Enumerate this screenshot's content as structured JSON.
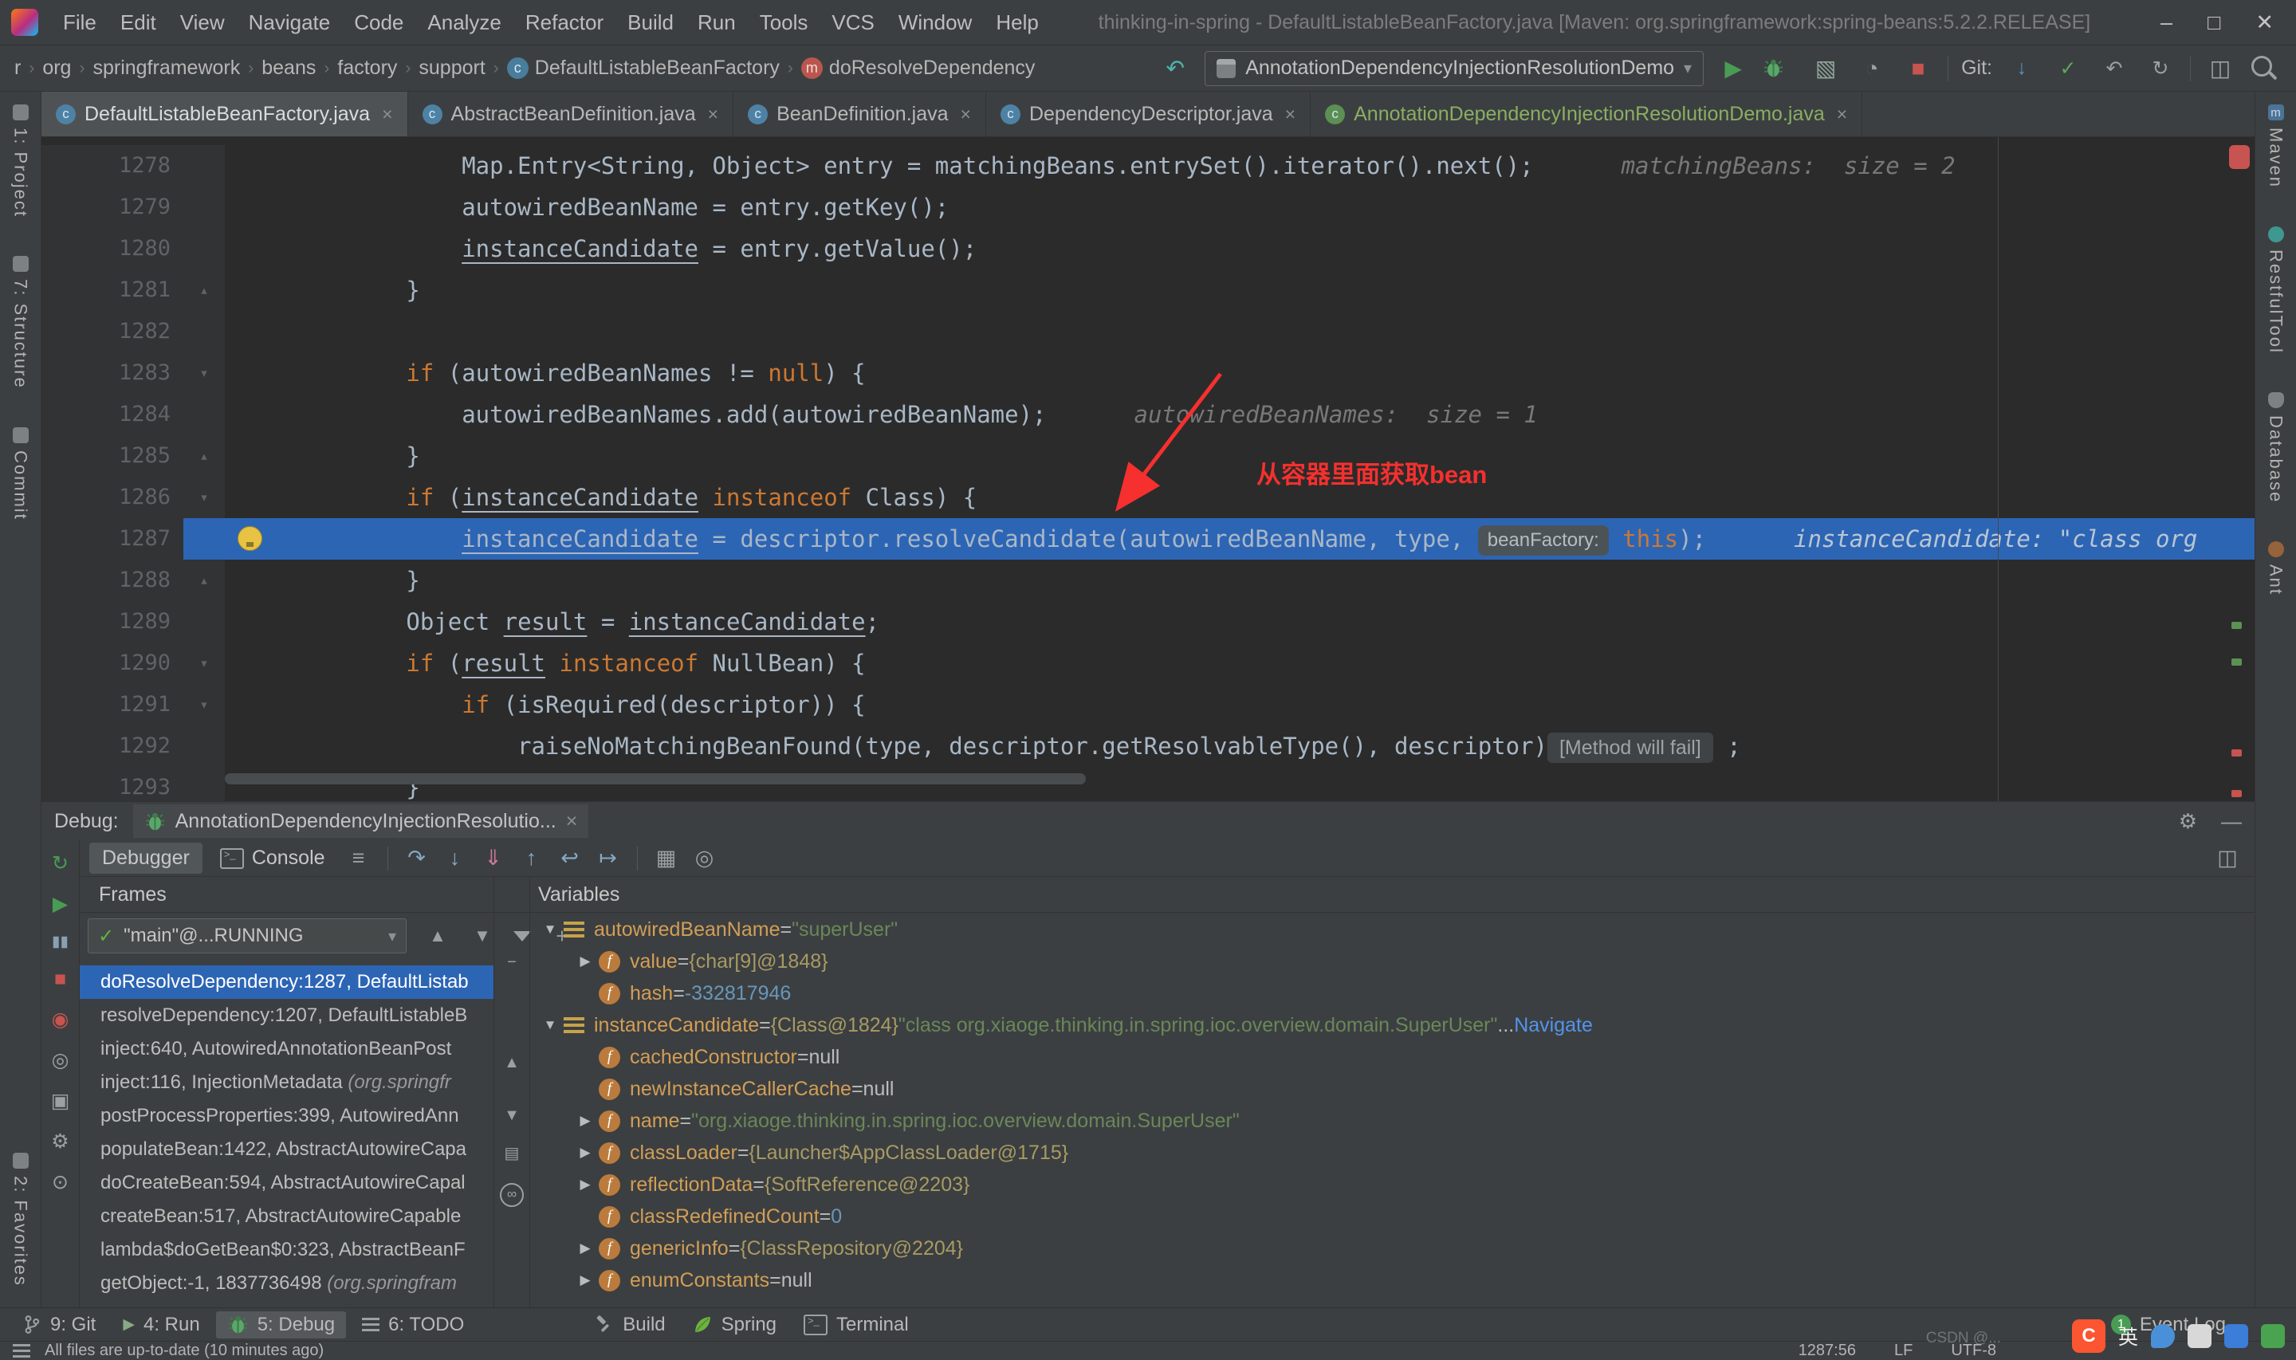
{
  "window": {
    "title": "thinking-in-spring - DefaultListableBeanFactory.java [Maven: org.springframework:spring-beans:5.2.2.RELEASE]"
  },
  "menu": {
    "items": [
      "File",
      "Edit",
      "View",
      "Navigate",
      "Code",
      "Analyze",
      "Refactor",
      "Build",
      "Run",
      "Tools",
      "VCS",
      "Window",
      "Help"
    ]
  },
  "toolbar": {
    "breadcrumbs": [
      {
        "label": "r"
      },
      {
        "label": "org"
      },
      {
        "label": "springframework"
      },
      {
        "label": "beans"
      },
      {
        "label": "factory"
      },
      {
        "label": "support"
      },
      {
        "label": "DefaultListableBeanFactory",
        "icon": "class"
      },
      {
        "label": "doResolveDependency",
        "icon": "method"
      }
    ],
    "run_config": "AnnotationDependencyInjectionResolutionDemo",
    "git_label": "Git:"
  },
  "tabs": [
    {
      "label": "DefaultListableBeanFactory.java",
      "active": true
    },
    {
      "label": "AbstractBeanDefinition.java"
    },
    {
      "label": "BeanDefinition.java"
    },
    {
      "label": "DependencyDescriptor.java"
    },
    {
      "label": "AnnotationDependencyInjectionResolutionDemo.java",
      "green": true
    }
  ],
  "editor": {
    "annotation": "从容器里面获取bean",
    "lines": [
      {
        "num": 1278,
        "ind": 16,
        "seg": [
          {
            "t": "Map.Entry<String, Object> entry = matchingBeans.entrySet().iterator().next();",
            "s": "d"
          }
        ],
        "hint": "matchingBeans:  size = 2"
      },
      {
        "num": 1279,
        "ind": 16,
        "seg": [
          {
            "t": "autowiredBeanName = entry.getKey();",
            "s": "d"
          }
        ]
      },
      {
        "num": 1280,
        "ind": 16,
        "seg": [
          {
            "t": "instanceCandidate",
            "s": "u"
          },
          {
            "t": " = entry.getValue();",
            "s": "d"
          }
        ]
      },
      {
        "num": 1281,
        "ind": 12,
        "seg": [
          {
            "t": "}",
            "s": "d"
          }
        ],
        "fold": "end"
      },
      {
        "num": 1282,
        "ind": 0,
        "seg": []
      },
      {
        "num": 1283,
        "ind": 12,
        "seg": [
          {
            "t": "if ",
            "s": "k"
          },
          {
            "t": "(autowiredBeanNames != ",
            "s": "d"
          },
          {
            "t": "null",
            "s": "k"
          },
          {
            "t": ") {",
            "s": "d"
          }
        ],
        "fold": "start"
      },
      {
        "num": 1284,
        "ind": 16,
        "seg": [
          {
            "t": "autowiredBeanNames.add(autowiredBeanName);",
            "s": "d"
          }
        ],
        "hint": "autowiredBeanNames:  size = 1"
      },
      {
        "num": 1285,
        "ind": 12,
        "seg": [
          {
            "t": "}",
            "s": "d"
          }
        ],
        "fold": "end"
      },
      {
        "num": 1286,
        "ind": 12,
        "seg": [
          {
            "t": "if ",
            "s": "k"
          },
          {
            "t": "(",
            "s": "d"
          },
          {
            "t": "instanceCandidate",
            "s": "u"
          },
          {
            "t": " ",
            "s": "d"
          },
          {
            "t": "instanceof ",
            "s": "k"
          },
          {
            "t": "Class) {",
            "s": "d"
          }
        ],
        "fold": "start"
      },
      {
        "num": 1287,
        "ind": 16,
        "current": true,
        "bulb": true,
        "seg": [
          {
            "t": "instanceCandidate",
            "s": "u"
          },
          {
            "t": " = descriptor.resolveCandidate(autowiredBeanName, type, ",
            "s": "d"
          },
          {
            "t": "beanFactory:",
            "s": "i"
          },
          {
            "t": " ",
            "s": "d"
          },
          {
            "t": "this",
            "s": "k"
          },
          {
            "t": ");",
            "s": "d"
          }
        ],
        "hint": "instanceCandidate: \"class org"
      },
      {
        "num": 1288,
        "ind": 12,
        "seg": [
          {
            "t": "}",
            "s": "d"
          }
        ],
        "fold": "end"
      },
      {
        "num": 1289,
        "ind": 12,
        "seg": [
          {
            "t": "Object ",
            "s": "d"
          },
          {
            "t": "result",
            "s": "u"
          },
          {
            "t": " = ",
            "s": "d"
          },
          {
            "t": "instanceCandidate",
            "s": "u"
          },
          {
            "t": ";",
            "s": "d"
          }
        ]
      },
      {
        "num": 1290,
        "ind": 12,
        "seg": [
          {
            "t": "if ",
            "s": "k"
          },
          {
            "t": "(",
            "s": "d"
          },
          {
            "t": "result",
            "s": "u"
          },
          {
            "t": " ",
            "s": "d"
          },
          {
            "t": "instanceof ",
            "s": "k"
          },
          {
            "t": "NullBean) {",
            "s": "d"
          }
        ],
        "fold": "start"
      },
      {
        "num": 1291,
        "ind": 16,
        "seg": [
          {
            "t": "if ",
            "s": "k"
          },
          {
            "t": "(isRequired(descriptor)) {",
            "s": "d"
          }
        ],
        "fold": "start"
      },
      {
        "num": 1292,
        "ind": 20,
        "seg": [
          {
            "t": "raiseNoMatchingBeanFound(type, descriptor.getResolvableType(), descriptor)",
            "s": "d"
          },
          {
            "t": " [Method will fail] ",
            "s": "i2"
          },
          {
            "t": " ;",
            "s": "d"
          }
        ]
      },
      {
        "num": 1293,
        "ind": 12,
        "seg": [
          {
            "t": "}",
            "s": "d"
          }
        ]
      }
    ]
  },
  "debug": {
    "label": "Debug:",
    "session_tab": "AnnotationDependencyInjectionResolutio...",
    "tabs": [
      {
        "label": "Debugger",
        "selected": true
      },
      {
        "label": "Console"
      }
    ],
    "frames": {
      "title": "Frames",
      "thread": "\"main\"@...RUNNING",
      "items": [
        {
          "text": "doResolveDependency:1287, DefaultListab",
          "selected": true
        },
        {
          "text": "resolveDependency:1207, DefaultListableB"
        },
        {
          "text": "inject:640, AutowiredAnnotationBeanPost"
        },
        {
          "text": "inject:116, InjectionMetadata ",
          "italic": "(org.springfr"
        },
        {
          "text": "postProcessProperties:399, AutowiredAnn"
        },
        {
          "text": "populateBean:1422, AbstractAutowireCapa"
        },
        {
          "text": "doCreateBean:594, AbstractAutowireCapal"
        },
        {
          "text": "createBean:517, AbstractAutowireCapable"
        },
        {
          "text": "lambda$doGetBean$0:323, AbstractBeanF"
        },
        {
          "text": "getObject:-1, 1837736498 ",
          "italic": "(org.springfram"
        }
      ]
    },
    "variables": {
      "title": "Variables",
      "items": [
        {
          "lvl": 0,
          "exp": "open",
          "icon": "variable",
          "name": "autowiredBeanName",
          "value": [
            {
              "t": " = ",
              "c": "eq"
            },
            {
              "t": "\"superUser\"",
              "c": "str"
            }
          ]
        },
        {
          "lvl": 1,
          "exp": "closed",
          "icon": "field",
          "name": "value",
          "value": [
            {
              "t": " = ",
              "c": "eq"
            },
            {
              "t": "{char[9]@1848}",
              "c": "ref"
            }
          ]
        },
        {
          "lvl": 1,
          "exp": "none",
          "icon": "field",
          "name": "hash",
          "value": [
            {
              "t": " = ",
              "c": "eq"
            },
            {
              "t": "-332817946",
              "c": "num"
            }
          ]
        },
        {
          "lvl": 0,
          "exp": "open",
          "icon": "variable",
          "name": "instanceCandidate",
          "value": [
            {
              "t": " = ",
              "c": "eq"
            },
            {
              "t": "{Class@1824} ",
              "c": "ref"
            },
            {
              "t": "\"class org.xiaoge.thinking.in.spring.ioc.overview.domain.SuperUser\"",
              "c": "str"
            },
            {
              "t": " ... ",
              "c": "eq"
            },
            {
              "t": "Navigate",
              "c": "link"
            }
          ]
        },
        {
          "lvl": 1,
          "exp": "none",
          "icon": "field",
          "name": "cachedConstructor",
          "value": [
            {
              "t": " = ",
              "c": "eq"
            },
            {
              "t": "null",
              "c": "null"
            }
          ]
        },
        {
          "lvl": 1,
          "exp": "none",
          "icon": "field",
          "name": "newInstanceCallerCache",
          "value": [
            {
              "t": " = ",
              "c": "eq"
            },
            {
              "t": "null",
              "c": "null"
            }
          ]
        },
        {
          "lvl": 1,
          "exp": "closed",
          "icon": "field",
          "name": "name",
          "value": [
            {
              "t": " = ",
              "c": "eq"
            },
            {
              "t": "\"org.xiaoge.thinking.in.spring.ioc.overview.domain.SuperUser\"",
              "c": "str"
            }
          ]
        },
        {
          "lvl": 1,
          "exp": "closed",
          "icon": "field",
          "name": "classLoader",
          "value": [
            {
              "t": " = ",
              "c": "eq"
            },
            {
              "t": "{Launcher$AppClassLoader@1715}",
              "c": "ref"
            }
          ]
        },
        {
          "lvl": 1,
          "exp": "closed",
          "icon": "field",
          "name": "reflectionData",
          "value": [
            {
              "t": " = ",
              "c": "eq"
            },
            {
              "t": "{SoftReference@2203}",
              "c": "ref"
            }
          ]
        },
        {
          "lvl": 1,
          "exp": "none",
          "icon": "field",
          "name": "classRedefinedCount",
          "value": [
            {
              "t": " = ",
              "c": "eq"
            },
            {
              "t": "0",
              "c": "num"
            }
          ]
        },
        {
          "lvl": 1,
          "exp": "closed",
          "icon": "field",
          "name": "genericInfo",
          "value": [
            {
              "t": " = ",
              "c": "eq"
            },
            {
              "t": "{ClassRepository@2204}",
              "c": "ref"
            }
          ]
        },
        {
          "lvl": 1,
          "exp": "closed",
          "icon": "field",
          "name": "enumConstants",
          "value": [
            {
              "t": " = ",
              "c": "eq"
            },
            {
              "t": "null",
              "c": "null"
            }
          ]
        }
      ]
    }
  },
  "status": {
    "buttons_left": [
      {
        "icon": "git-branch",
        "label": "9: Git"
      },
      {
        "icon": "run",
        "label": "4: Run"
      },
      {
        "icon": "debug",
        "label": "5: Debug",
        "selected": true
      },
      {
        "icon": "todo",
        "label": "6: TODO"
      }
    ],
    "buttons_mid": [
      {
        "icon": "build",
        "label": "Build"
      },
      {
        "icon": "spring",
        "label": "Spring"
      },
      {
        "icon": "terminal",
        "label": "Terminal"
      }
    ],
    "buttons_right": [
      {
        "icon": "event",
        "label": "Event Log",
        "badge": "1"
      }
    ],
    "message": "All files are up-to-date (10 minutes ago)",
    "caret": "1287:56",
    "line_ending": "LF",
    "encoding": "UTF-8"
  },
  "left_bar": {
    "top": [
      {
        "label": "1: Project",
        "icon": "project"
      },
      {
        "label": "7: Structure",
        "icon": "structure"
      },
      {
        "label": "Commit",
        "icon": "commit"
      }
    ],
    "bottom": [
      {
        "label": "2: Favorites",
        "icon": "favorites"
      }
    ]
  },
  "right_bar": {
    "top": [
      {
        "label": "Maven",
        "icon": "maven"
      },
      {
        "label": "RestfulTool",
        "icon": "restful"
      },
      {
        "label": "Database",
        "icon": "database"
      },
      {
        "label": "Ant",
        "icon": "ant"
      }
    ]
  },
  "watermark": {
    "logo": "C",
    "ime": "英",
    "text": "CSDN @..."
  }
}
